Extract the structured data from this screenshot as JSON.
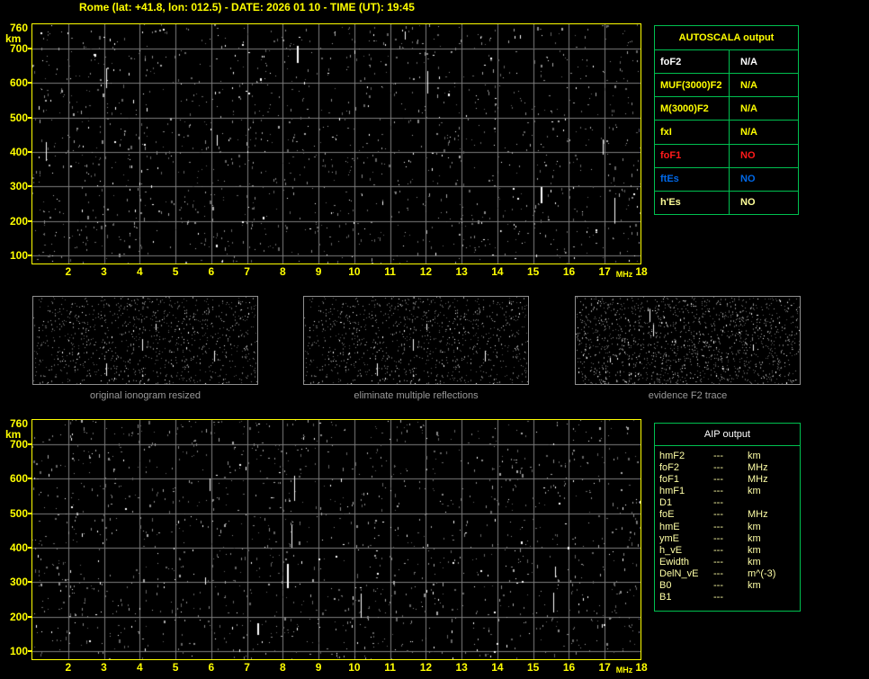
{
  "title": "Rome (lat: +41.8, lon: 012.5) - DATE: 2026 01 10 - TIME (UT): 19:45",
  "colors": {
    "yellow": "#ffff00",
    "table_green": "#00c050",
    "grid_gray": "#7d7d7d",
    "caption_gray": "#9a9a9a",
    "aip_text": "#ffffa6",
    "red": "#ff1a1a",
    "blue": "#0068e8",
    "pale_yellow": "#ffff99",
    "white": "#ffffff"
  },
  "ionogram_axes": {
    "y_top_label": "760",
    "y_unit": "km",
    "y_ticks": [
      "700",
      "600",
      "500",
      "400",
      "300",
      "200",
      "100"
    ],
    "x_ticks": [
      "2",
      "3",
      "4",
      "5",
      "6",
      "7",
      "8",
      "9",
      "10",
      "11",
      "12",
      "13",
      "14",
      "15",
      "16",
      "17"
    ],
    "x_last_tick": "18",
    "x_unit": "MHz"
  },
  "autoscala_table": {
    "title": "AUTOSCALA output",
    "rows": [
      {
        "label": "foF2",
        "value": "N/A",
        "color": "#ffffff"
      },
      {
        "label": "MUF(3000)F2",
        "value": "N/A",
        "color": "#ffff00"
      },
      {
        "label": "M(3000)F2",
        "value": "N/A",
        "color": "#ffff00"
      },
      {
        "label": "fxI",
        "value": "N/A",
        "color": "#ffff00"
      },
      {
        "label": "foF1",
        "value": "NO",
        "color": "#ff1a1a"
      },
      {
        "label": "ftEs",
        "value": "NO",
        "color": "#0068e8"
      },
      {
        "label": "h'Es",
        "value": "NO",
        "color": "#ffff99"
      }
    ]
  },
  "panels": [
    {
      "caption": "original ionogram resized"
    },
    {
      "caption": "eliminate multiple reflections"
    },
    {
      "caption": "evidence F2 trace"
    }
  ],
  "aip_table": {
    "title": "AIP output",
    "rows": [
      {
        "label": "hmF2",
        "value": "---",
        "unit": "km"
      },
      {
        "label": "foF2",
        "value": "---",
        "unit": "MHz"
      },
      {
        "label": "foF1",
        "value": "---",
        "unit": "MHz"
      },
      {
        "label": "hmF1",
        "value": "---",
        "unit": "km"
      },
      {
        "label": "D1",
        "value": "---",
        "unit": ""
      },
      {
        "label": "foE",
        "value": "---",
        "unit": "MHz"
      },
      {
        "label": "hmE",
        "value": "---",
        "unit": "km"
      },
      {
        "label": "ymE",
        "value": "---",
        "unit": "km"
      },
      {
        "label": "h_vE",
        "value": "---",
        "unit": "km"
      },
      {
        "label": "Ewidth",
        "value": "---",
        "unit": "km"
      },
      {
        "label": "DelN_vE",
        "value": "---",
        "unit": "m^(-3)"
      },
      {
        "label": "B0",
        "value": "---",
        "unit": "km"
      },
      {
        "label": "B1",
        "value": "---",
        "unit": ""
      }
    ]
  }
}
